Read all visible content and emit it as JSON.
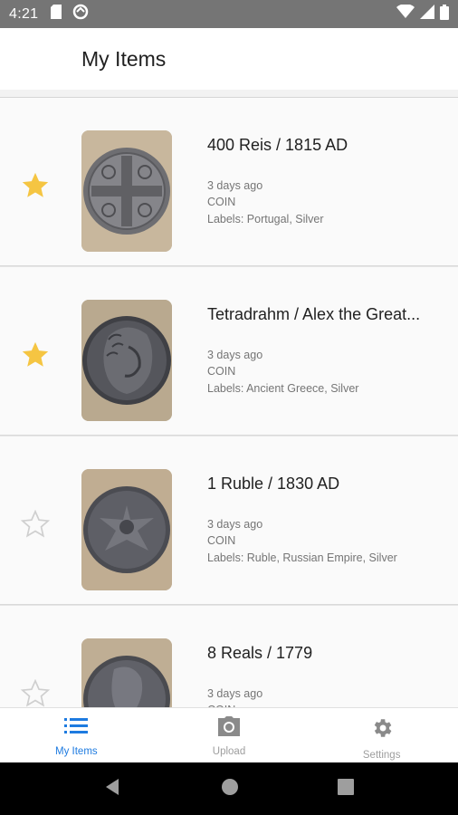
{
  "status_bar": {
    "time": "4:21",
    "icons": [
      "sd-card-icon",
      "data-saver-icon",
      "wifi-icon",
      "cellular-signal-icon",
      "battery-icon"
    ]
  },
  "app_bar": {
    "title": "My Items"
  },
  "items": [
    {
      "title": "400 Reis / 1815 AD",
      "date": "3 days ago",
      "type": "COIN",
      "labels": "Labels: Portugal, Silver",
      "starred": true
    },
    {
      "title": "Tetradrahm / Alex the Great...",
      "date": "3 days ago",
      "type": "COIN",
      "labels": "Labels: Ancient Greece, Silver",
      "starred": true
    },
    {
      "title": "1 Ruble / 1830 AD",
      "date": "3 days ago",
      "type": "COIN",
      "labels": "Labels: Ruble, Russian Empire, Silver",
      "starred": false
    },
    {
      "title": "8 Reals / 1779",
      "date": "3 days ago",
      "type": "COIN",
      "labels": "",
      "starred": false
    }
  ],
  "bottom_nav": [
    {
      "label": "My Items",
      "icon": "list-icon",
      "active": true
    },
    {
      "label": "Upload",
      "icon": "camera-icon",
      "active": false
    },
    {
      "label": "Settings",
      "icon": "gear-icon",
      "active": false
    }
  ],
  "system_nav": {
    "icons": [
      "back-icon",
      "home-icon",
      "recents-icon"
    ]
  },
  "colors": {
    "accent": "#1e7be0",
    "star_filled": "#f5c542",
    "status_bar": "#757575"
  }
}
